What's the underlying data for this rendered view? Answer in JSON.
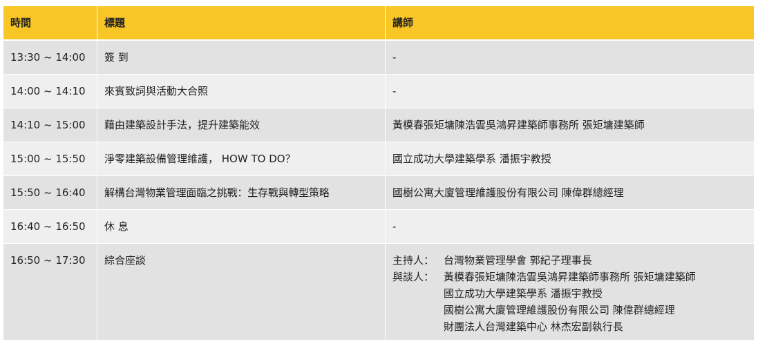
{
  "table": {
    "headers": {
      "time": "時間",
      "title": "標題",
      "speaker": "講師"
    },
    "rows": [
      {
        "time": "13:30 ~ 14:00",
        "title": "簽 到",
        "speaker": "-"
      },
      {
        "time": "14:00 ~ 14:10",
        "title": "來賓致詞與活動大合照",
        "speaker": "-"
      },
      {
        "time": "14:10 ~ 15:00",
        "title": "藉由建築設計手法，提升建築能效",
        "speaker": "黃模春張矩墉陳浩雲吳鴻昇建築師事務所 張矩墉建築師"
      },
      {
        "time": "15:00 ~ 15:50",
        "title": "淨零建築設備管理維護， HOW TO DO？",
        "speaker": "國立成功大學建築學系 潘振宇教授"
      },
      {
        "time": "15:50 ~ 16:40",
        "title": "解構台灣物業管理面臨之挑戰：生存戰與轉型策略",
        "speaker": "國樹公寓大廈管理維護股份有限公司 陳偉群總經理"
      },
      {
        "time": "16:40 ~ 16:50",
        "title": "休 息",
        "speaker": "-"
      }
    ],
    "panel_row": {
      "time": "16:50 ~ 17:30",
      "title": "綜合座談",
      "host_label": "主持人：",
      "host": "台灣物業管理學會 郭紀子理事長",
      "panelists_label": "與談人：",
      "panelists": [
        "黃模春張矩墉陳浩雲吳鴻昇建築師事務所 張矩墉建築師",
        "國立成功大學建築學系 潘振宇教授",
        "國樹公寓大廈管理維護股份有限公司 陳偉群總經理",
        "財團法人台灣建築中心 林杰宏副執行長"
      ]
    }
  },
  "colors": {
    "header_bg": "#f8c626",
    "row_dark": "#e2e2e2",
    "row_light": "#efefef"
  }
}
